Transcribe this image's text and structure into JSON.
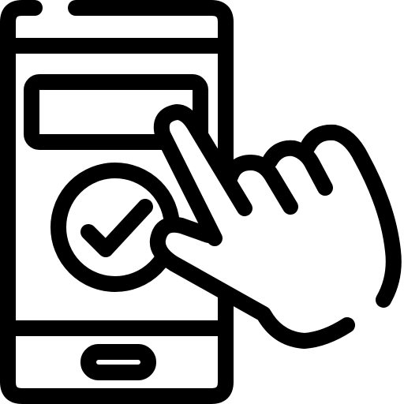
{
  "icon": {
    "name": "smartphone-tap-confirm-icon",
    "stroke_color": "#000000",
    "background_color": "#ffffff"
  }
}
